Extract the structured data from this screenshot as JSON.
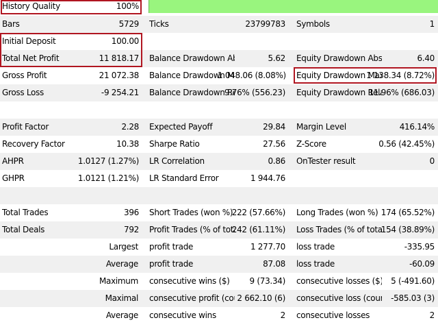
{
  "report": {
    "history_quality": {
      "label": "History Quality",
      "value": "100%",
      "fill_fraction": 1.0,
      "bar_color": "#99f57e"
    },
    "bars": {
      "label": "Bars",
      "value": "5729"
    },
    "ticks": {
      "label": "Ticks",
      "value": "23799783"
    },
    "symbols": {
      "label": "Symbols",
      "value": "1"
    },
    "initial_deposit": {
      "label": "Initial Deposit",
      "value": "100.00"
    },
    "total_net_profit": {
      "label": "Total Net Profit",
      "value": "11 818.17"
    },
    "balance_dd_abs": {
      "label": "Balance Drawdown Abs...",
      "value": "5.62"
    },
    "equity_dd_abs": {
      "label": "Equity Drawdown Absol...",
      "value": "6.40"
    },
    "gross_profit": {
      "label": "Gross Profit",
      "value": "21 072.38"
    },
    "balance_dd_max": {
      "label": "Balance Drawdown Max...",
      "value": "1 048.06 (8.08%)"
    },
    "equity_dd_max": {
      "label": "Equity Drawdown Maxi...",
      "value": "1 138.34 (8.72%)"
    },
    "gross_loss": {
      "label": "Gross Loss",
      "value": "-9 254.21"
    },
    "balance_dd_rel": {
      "label": "Balance Drawdown Rel...",
      "value": "9.76% (556.23)"
    },
    "equity_dd_rel": {
      "label": "Equity Drawdown Relati...",
      "value": "11.96% (686.03)"
    },
    "profit_factor": {
      "label": "Profit Factor",
      "value": "2.28"
    },
    "expected_payoff": {
      "label": "Expected Payoff",
      "value": "29.84"
    },
    "margin_level": {
      "label": "Margin Level",
      "value": "416.14%"
    },
    "recovery_factor": {
      "label": "Recovery Factor",
      "value": "10.38"
    },
    "sharpe_ratio": {
      "label": "Sharpe Ratio",
      "value": "27.56"
    },
    "z_score": {
      "label": "Z-Score",
      "value": "0.56 (42.45%)"
    },
    "ahpr": {
      "label": "AHPR",
      "value": "1.0127 (1.27%)"
    },
    "lr_correlation": {
      "label": "LR Correlation",
      "value": "0.86"
    },
    "ontester_result": {
      "label": "OnTester result",
      "value": "0"
    },
    "ghpr": {
      "label": "GHPR",
      "value": "1.0121 (1.21%)"
    },
    "lr_std_error": {
      "label": "LR Standard Error",
      "value": "1 944.76"
    },
    "total_trades": {
      "label": "Total Trades",
      "value": "396"
    },
    "short_trades": {
      "label": "Short Trades (won %)",
      "value": "222 (57.66%)"
    },
    "long_trades": {
      "label": "Long Trades (won %)",
      "value": "174 (65.52%)"
    },
    "total_deals": {
      "label": "Total Deals",
      "value": "792"
    },
    "profit_trades": {
      "label": "Profit Trades (% of total)",
      "value": "242 (61.11%)"
    },
    "loss_trades": {
      "label": "Loss Trades (% of total)",
      "value": "154 (38.89%)"
    },
    "largest": {
      "prefix": "Largest",
      "label2": "profit trade",
      "value2": "1 277.70",
      "label3": "loss trade",
      "value3": "-335.95"
    },
    "average1": {
      "prefix": "Average",
      "label2": "profit trade",
      "value2": "87.08",
      "label3": "loss trade",
      "value3": "-60.09"
    },
    "maximum": {
      "prefix": "Maximum",
      "label2": "consecutive wins ($)",
      "value2": "9 (73.34)",
      "label3": "consecutive losses ($)",
      "value3": "5 (-491.60)"
    },
    "maximal": {
      "prefix": "Maximal",
      "label2": "consecutive profit (count)",
      "value2": "2 662.10 (6)",
      "label3": "consecutive loss (count)",
      "value3": "-585.03 (3)"
    },
    "average2": {
      "prefix": "Average",
      "label2": "consecutive wins",
      "value2": "2",
      "label3": "consecutive losses",
      "value3": "2"
    }
  },
  "highlight_color": "#b01520"
}
